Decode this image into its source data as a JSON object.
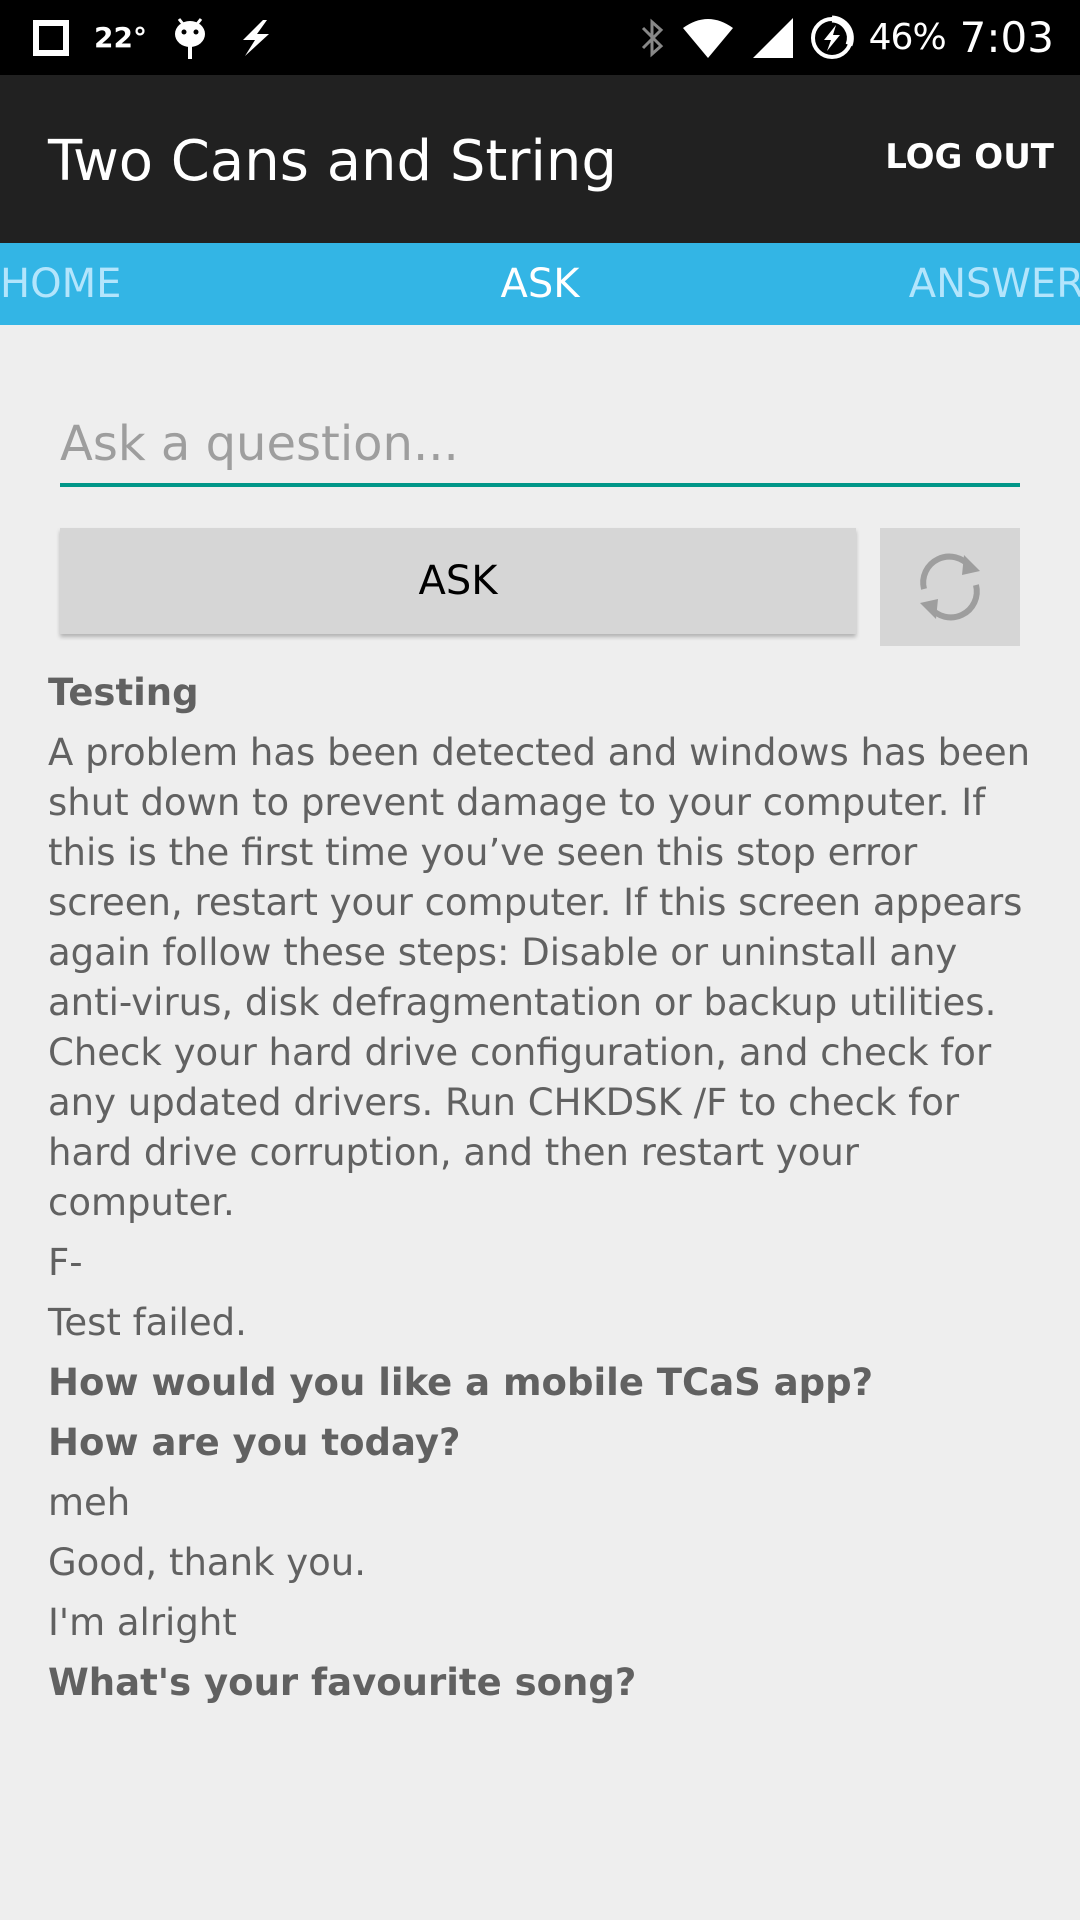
{
  "status_bar": {
    "temperature": "22°",
    "battery": "46%",
    "time": "7:03"
  },
  "app_bar": {
    "title": "Two Cans and String",
    "logout_label": "LOG OUT"
  },
  "tabs": [
    {
      "label": "HOME"
    },
    {
      "label": "ASK"
    },
    {
      "label": "ANSWER"
    }
  ],
  "ask": {
    "placeholder": "Ask a question...",
    "button_label": "ASK"
  },
  "entries": [
    {
      "type": "question",
      "text": "Testing"
    },
    {
      "type": "answer",
      "text": "A problem has been detected and windows has been shut down to prevent damage to your computer. If this is the first time you’ve seen this stop error screen, restart your computer. If this screen appears again follow these steps: Disable or uninstall any anti-virus, disk defragmentation or backup utilities. Check your hard drive configuration, and check for any updated drivers. Run CHKDSK /F to check for hard drive corruption, and then restart your computer."
    },
    {
      "type": "answer",
      "text": "F-"
    },
    {
      "type": "answer",
      "text": "Test failed."
    },
    {
      "type": "question",
      "text": "How would you like a mobile TCaS app?"
    },
    {
      "type": "question",
      "text": "How are you today?"
    },
    {
      "type": "answer",
      "text": "meh"
    },
    {
      "type": "answer",
      "text": "Good, thank you."
    },
    {
      "type": "answer",
      "text": "I'm alright"
    },
    {
      "type": "question",
      "text": "What's your favourite song?"
    }
  ],
  "colors": {
    "app_bar": "#212121",
    "tab_bar": "#33b5e5",
    "input_underline": "#009688",
    "background": "#eeeeee"
  },
  "icons": [
    "square-notification-icon",
    "android-notification-icon",
    "flash-notification-icon",
    "bluetooth-icon",
    "wifi-icon",
    "signal-icon",
    "battery-charging-icon",
    "refresh-icon"
  ]
}
